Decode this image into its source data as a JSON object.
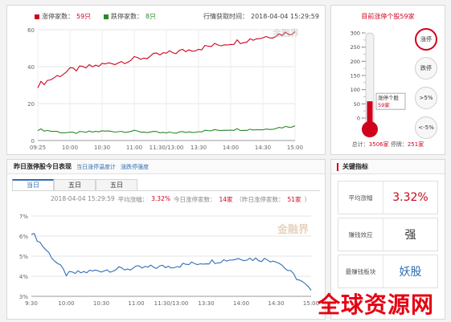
{
  "top_chart": {
    "legend_up_label": "涨停家数：",
    "legend_up_count": "59只",
    "legend_down_label": "跌停家数：",
    "legend_down_count": "8只",
    "time_label": "行情获取时间：",
    "time_value": "2018-04-04  15:29:59",
    "watermark": "金融界"
  },
  "thermometer": {
    "title": "目前涨停个股59家",
    "scale": [
      "300",
      "250",
      "200",
      "150",
      "100",
      "50",
      "0"
    ],
    "bubble_line1": "涨停个股",
    "bubble_line2": "59家",
    "level": 59,
    "scale_max": 300,
    "buttons": [
      "涨停",
      "跌停",
      ">5%",
      "<-5%"
    ],
    "footer_total_label": "总计：",
    "footer_total_value": "3506家",
    "footer_down_label": " 停牌：",
    "footer_down_value": "251家"
  },
  "section2": {
    "title": "昨日涨停股今日表现",
    "links": [
      "当日涨停温度计",
      "涨跌停强度"
    ],
    "tabs": [
      "当日",
      "五日",
      "五日"
    ],
    "info_date": "2018-04-04  15:29:59",
    "avg_label": "平均涨幅：",
    "avg_value": "3.32%",
    "limit_label": "今日涨停家数：",
    "limit_value": "14家",
    "prev_label": "（昨日涨停家数：",
    "prev_value": "51家",
    "prev_suffix": "）",
    "watermark": "金融界"
  },
  "kpi": {
    "title": "关键指标",
    "rows": [
      {
        "label": "平均涨幅",
        "value": "3.32%"
      },
      {
        "label": "赚钱效应",
        "value": "强"
      },
      {
        "label": "最赚钱板块",
        "value": "妖股"
      }
    ]
  },
  "site_watermark": "全球资源网",
  "colors": {
    "up": "#d0021b",
    "down": "#2a8a2a",
    "line2": "#2f6db5",
    "accent_blue": "#2f6db5"
  },
  "chart_data": [
    {
      "type": "line",
      "x": [
        "09:25",
        "10:00",
        "10:30",
        "11:00",
        "11:30/13:00",
        "13:30",
        "14:00",
        "14:30",
        "15:00"
      ],
      "ylim": [
        0,
        60
      ],
      "yticks": [
        "0",
        "20",
        "40",
        "60"
      ],
      "series": [
        {
          "name": "涨停家数",
          "values": [
            30,
            38,
            41,
            44,
            47,
            50,
            53,
            56,
            59
          ]
        },
        {
          "name": "跌停家数",
          "values": [
            6,
            4,
            5,
            5,
            4,
            5,
            6,
            6,
            8
          ]
        }
      ]
    },
    {
      "type": "line",
      "x": [
        "9:30",
        "10:00",
        "10:30",
        "11:00",
        "11:30/13:00",
        "13:30",
        "14:00",
        "14:30",
        "15:00"
      ],
      "ylim": [
        3,
        7
      ],
      "yticks": [
        "3%",
        "4%",
        "5%",
        "6%",
        "7%"
      ],
      "series": [
        {
          "name": "",
          "values": [
            6.2,
            4.1,
            4.3,
            4.4,
            4.5,
            4.7,
            4.9,
            4.8,
            3.3
          ]
        }
      ]
    }
  ]
}
